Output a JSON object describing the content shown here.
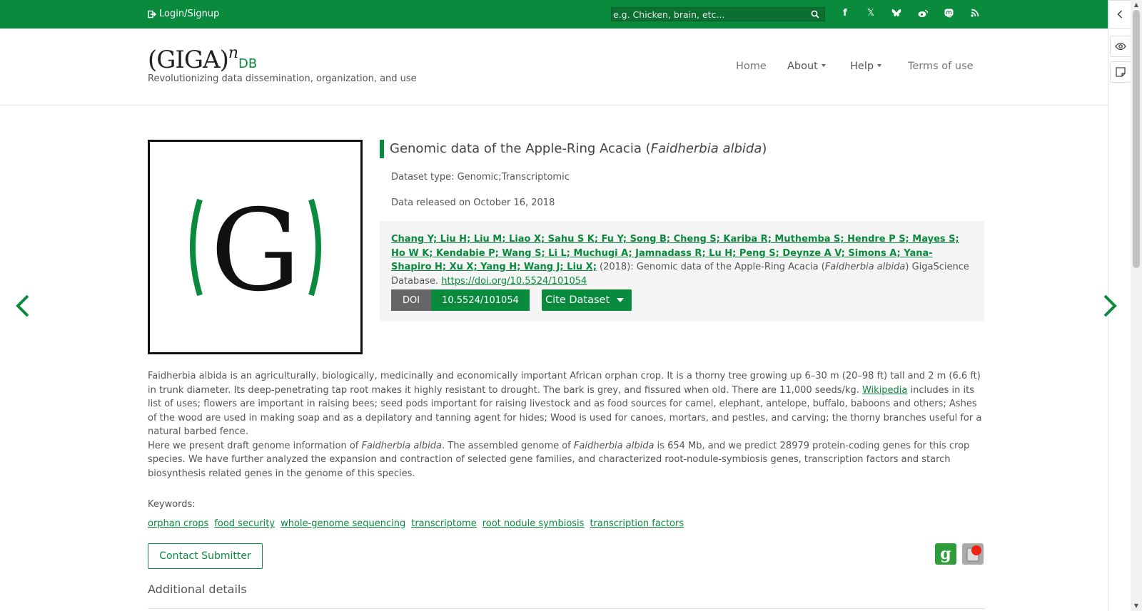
{
  "topbar": {
    "login_label": "Login/Signup",
    "search_placeholder": "e.g. Chicken, brain, etc...",
    "social_icons": [
      "facebook-icon",
      "x-icon",
      "bluesky-icon",
      "weibo-icon",
      "mastodon-icon",
      "rss-icon"
    ]
  },
  "header": {
    "logo_main": "(GIGA)",
    "logo_sup": "n",
    "logo_db": "DB",
    "tagline": "Revolutionizing data dissemination, organization, and use",
    "nav": {
      "home": "Home",
      "about": "About",
      "help": "Help",
      "terms": "Terms of use"
    }
  },
  "dataset": {
    "title_prefix": "Genomic data of the Apple-Ring Acacia (",
    "title_species": "Faidherbia albida",
    "title_suffix": ")",
    "type": "Dataset type: Genomic;Transcriptomic",
    "released": "Data released on October 16, 2018",
    "citation": {
      "authors": "Chang Y; Liu H; Liu M; Liao X; Sahu S K; Fu Y; Song B; Cheng S; Kariba R; Muthemba S; Hendre P S; Mayes S; Ho W K; Kendabie P; Wang S; Li L; Muchugi A; Jamnadass R; Lu H; Peng S; Deynze A V; Simons A; Yana-Shapiro H; Xu X; Yang H; Wang J; Liu X;",
      "year_part": " (2018): Genomic data of the Apple-Ring Acacia (",
      "species": "Faidherbia albida",
      "after_species": ") GigaScience Database. ",
      "doi_url": "https://doi.org/10.5524/101054"
    },
    "doi_label": "DOI",
    "doi_value": "10.5524/101054",
    "cite_button": "Cite Dataset"
  },
  "description": {
    "p1_a": "Faidherbia albida is an agriculturally, biologically, medicinally and economically important African orphan crop. It is a thorny tree growing up 6–30 m (20–98 ft) tall and 2 m (6.6 ft) in trunk diameter. Its deep-penetrating tap root makes it highly resistant to drought. The bark is grey, and fissured when old. There are 11,000 seeds/kg. ",
    "p1_link": "Wikipedia",
    "p1_b": " includes in its list of uses; flowers are important in raising bees; seed pods important for raising livestock and as food sources for camel, elephant, antelope, buffalo, baboons and others; Ashes of the wood are used in making soap and as a depilatory and tanning agent for hides; Wood is used for canoes, mortars, and pestles, and carving; the thorny branches useful for a natural barbed fence.",
    "p2_a": "Here we present draft genome information of ",
    "p2_species1": "Faidherbia albida",
    "p2_b": ". The assembled genome of ",
    "p2_species2": "Faidherbia albida",
    "p2_c": " is 654 Mb, and we predict 28979 protein-coding genes for this crop species. We have further analyzed the expansion and contraction of selected gene families, and characterized root-nodule-symbiosis genes, transcription factors and starch biosynthesis related genes in the genome of this species."
  },
  "keywords": {
    "label": "Keywords:",
    "items": [
      "orphan crops",
      "food security",
      "whole-genome sequencing",
      "transcriptome",
      "root nodule symbiosis",
      "transcription factors"
    ]
  },
  "contact_button": "Contact Submitter",
  "additional_details": "Additional details",
  "colors": {
    "brand_green": "#0a8a3c",
    "doi_gray": "#666666",
    "citation_bg": "#f5f5f5"
  }
}
